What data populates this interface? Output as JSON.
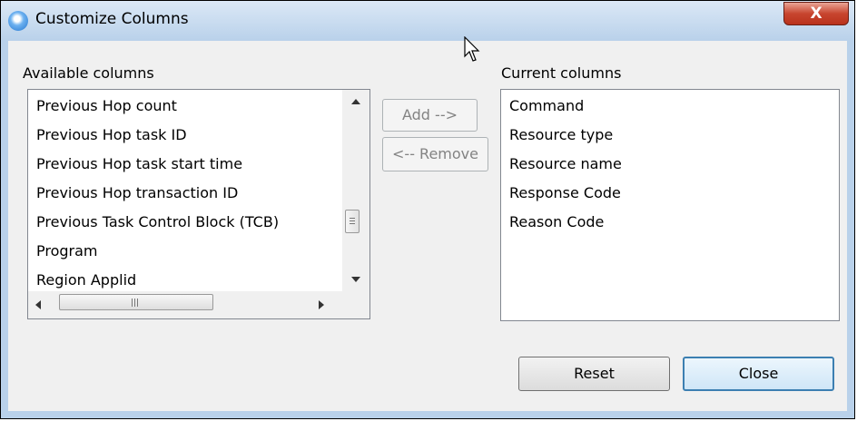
{
  "window": {
    "title": "Customize Columns",
    "close_glyph": "X"
  },
  "available": {
    "label": "Available columns",
    "items": [
      "Previous Hop count",
      "Previous Hop task ID",
      "Previous Hop task start time",
      "Previous Hop transaction ID",
      "Previous Task Control Block (TCB)",
      "Program",
      "Region Applid"
    ]
  },
  "current": {
    "label": "Current columns",
    "items": [
      "Command",
      "Resource type",
      "Resource name",
      "Response Code",
      "Reason Code"
    ]
  },
  "buttons": {
    "add": "Add -->",
    "remove": "<-- Remove",
    "reset": "Reset",
    "close": "Close"
  },
  "icons": {
    "app": "app-star-icon",
    "close": "close-icon",
    "cursor": "mouse-pointer-icon"
  },
  "colors": {
    "title_bar": "#b9d1ea",
    "close_button": "#c8452f",
    "default_button_border": "#3c7fb1"
  }
}
